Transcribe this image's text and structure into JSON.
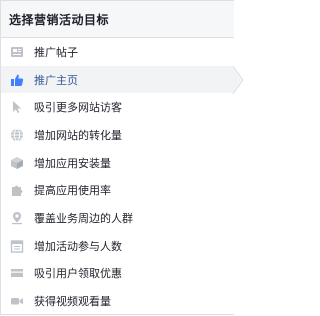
{
  "header": {
    "title": "选择营销活动目标"
  },
  "colors": {
    "icon_gray": "#bec3c9",
    "active_blue": "#4080ff",
    "active_text": "#365899",
    "active_bg": "#f2f3f5"
  },
  "objectives": [
    {
      "label": "推广帖子",
      "icon": "post-icon"
    },
    {
      "label": "推广主页",
      "icon": "thumbs-up-icon",
      "selected": true
    },
    {
      "label": "吸引更多网站访客",
      "icon": "cursor-icon"
    },
    {
      "label": "增加网站的转化量",
      "icon": "globe-icon"
    },
    {
      "label": "增加应用安装量",
      "icon": "cube-icon"
    },
    {
      "label": "提高应用使用率",
      "icon": "puzzle-icon"
    },
    {
      "label": "覆盖业务周边的人群",
      "icon": "map-pin-icon"
    },
    {
      "label": "增加活动参与人数",
      "icon": "calendar-icon"
    },
    {
      "label": "吸引用户领取优惠",
      "icon": "offer-icon"
    },
    {
      "label": "获得视频观看量",
      "icon": "video-icon"
    }
  ]
}
